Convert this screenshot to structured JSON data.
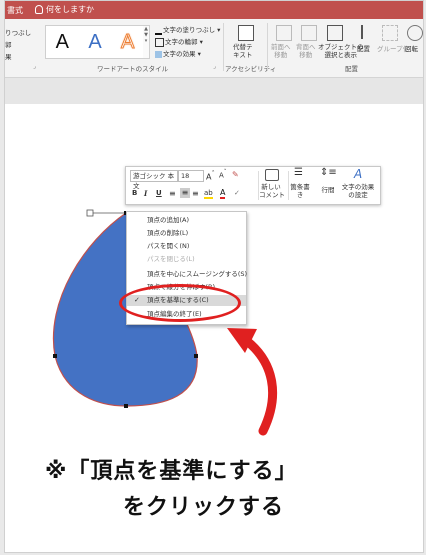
{
  "titlebar": {
    "tab": "書式",
    "tell_me": "何をしますか"
  },
  "ribbon": {
    "left_partial": [
      "りつぶし",
      "郭",
      "果"
    ],
    "wordart_letters": [
      "A",
      "A",
      "A"
    ],
    "wordart_fill": "文字の塗りつぶし",
    "wordart_outline": "文字の輪郭",
    "wordart_effect": "文字の効果",
    "wordart_group_label": "ワードアートのスタイル",
    "alt_text_label": "代替テ\nキスト",
    "accessibility_label": "アクセシビリティ",
    "bring_forward": "前面へ\n移動",
    "send_backward": "背面へ\n移動",
    "selection_pane": "オブジェクトの\n選択と表示",
    "align": "配置",
    "group": "グループ化",
    "rotate": "回転",
    "arrange_label": "配置"
  },
  "mini_toolbar": {
    "font_name": "游ゴシック 本文",
    "font_size": "18",
    "bold": "B",
    "italic": "I",
    "underline": "U",
    "new_comment": "新しい\nコメント",
    "bullets": "箇条書\nき",
    "line_spacing": "行間",
    "text_effects": "文字の効果\nの設定"
  },
  "context_menu": {
    "items": [
      {
        "label": "頂点の追加(A)",
        "disabled": false,
        "checked": false,
        "highlight": false
      },
      {
        "label": "頂点の削除(L)",
        "disabled": false,
        "checked": false,
        "highlight": false
      },
      {
        "label": "パスを開く(N)",
        "disabled": false,
        "checked": false,
        "highlight": false
      },
      {
        "label": "パスを閉じる(L)",
        "disabled": true,
        "checked": false,
        "highlight": false
      },
      {
        "label": "頂点を中心にスムージングする(S)",
        "disabled": false,
        "checked": false,
        "highlight": false
      },
      {
        "label": "頂点で線分を伸ばす(R)",
        "disabled": false,
        "checked": false,
        "highlight": false
      },
      {
        "label": "頂点を基準にする(C)",
        "disabled": false,
        "checked": true,
        "highlight": true
      },
      {
        "label": "頂点編集の終了(E)",
        "disabled": false,
        "checked": false,
        "highlight": false
      }
    ]
  },
  "annotation": {
    "line1": "※「頂点を基準にする」",
    "line2": "をクリックする"
  },
  "colors": {
    "shape_fill": "#4472c4",
    "shape_outline": "#c0504d",
    "highlight_ring": "#e02020",
    "title_bar": "#c0504d"
  }
}
